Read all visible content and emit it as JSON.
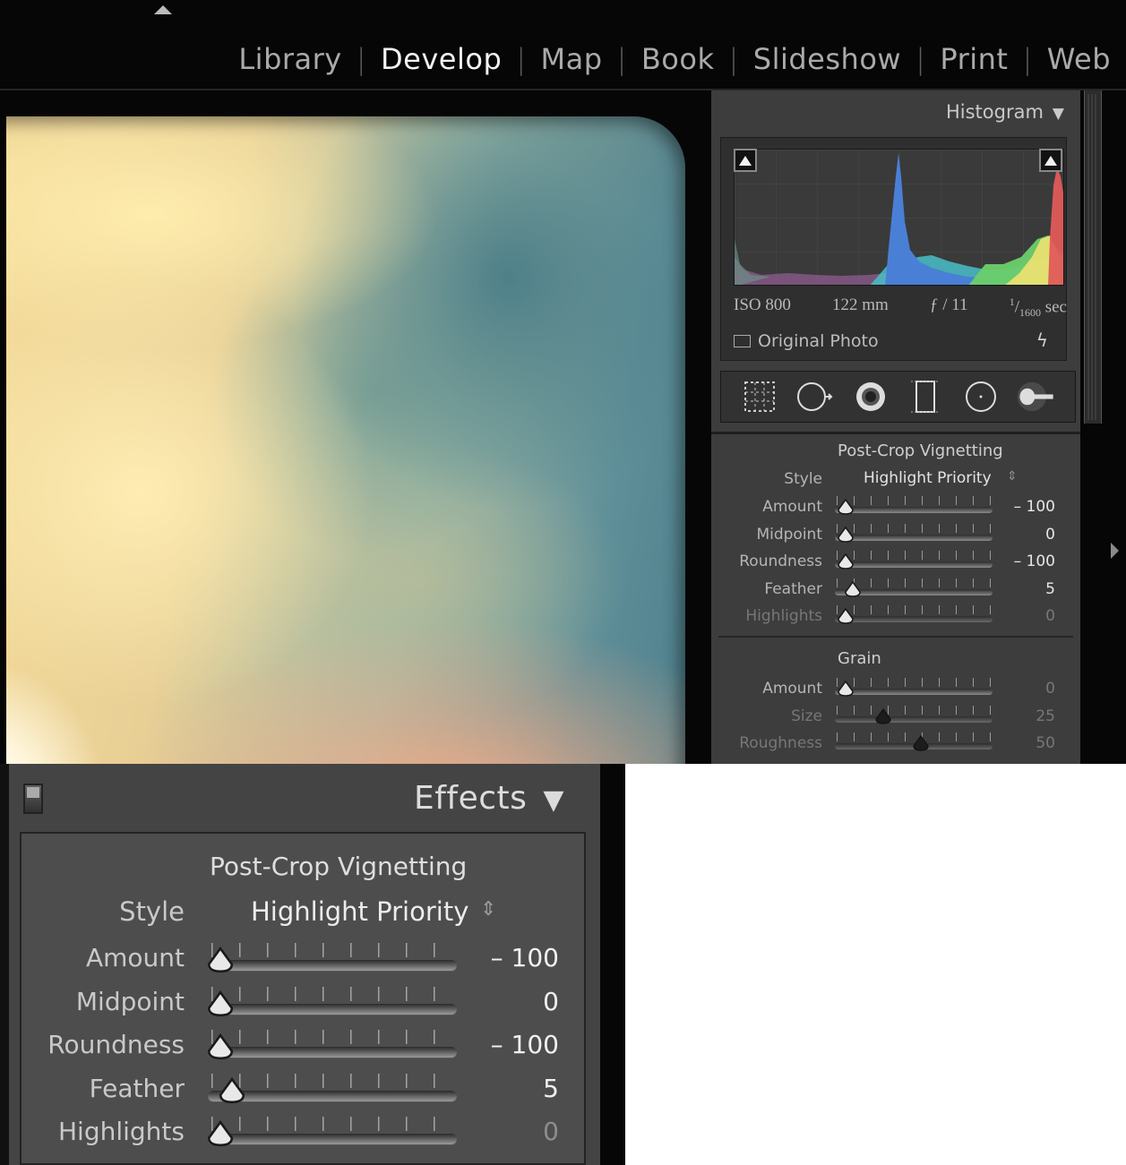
{
  "module_nav": {
    "items": [
      {
        "label": "Library",
        "active": false
      },
      {
        "label": "Develop",
        "active": true
      },
      {
        "label": "Map",
        "active": false
      },
      {
        "label": "Book",
        "active": false
      },
      {
        "label": "Slideshow",
        "active": false
      },
      {
        "label": "Print",
        "active": false
      },
      {
        "label": "Web",
        "active": false
      }
    ],
    "separator": "|"
  },
  "histogram": {
    "title": "Histogram",
    "collapse_icon": "triangle-down-icon",
    "exif": {
      "iso": "ISO 800",
      "focal_length": "122 mm",
      "aperture": "ƒ / 11",
      "shutter_num": "1",
      "shutter_den": "1600",
      "shutter_unit": "sec"
    },
    "original_photo_label": "Original Photo",
    "bolt_icon": "lightning-icon"
  },
  "tools": [
    {
      "name": "crop-overlay-icon",
      "glyph": "⬚"
    },
    {
      "name": "spot-removal-icon",
      "glyph": "◯"
    },
    {
      "name": "red-eye-icon",
      "glyph": "◉"
    },
    {
      "name": "graduated-filter-icon",
      "glyph": "▯"
    },
    {
      "name": "radial-filter-icon",
      "glyph": "◌"
    },
    {
      "name": "adjustment-brush-icon",
      "glyph": "⊶"
    }
  ],
  "vignetting": {
    "title": "Post-Crop Vignetting",
    "style_label": "Style",
    "style_value": "Highlight Priority",
    "sliders": [
      {
        "key": "amount",
        "label": "Amount",
        "value": "– 100",
        "fraction": 0.0,
        "dim": false
      },
      {
        "key": "midpoint",
        "label": "Midpoint",
        "value": "0",
        "fraction": 0.0,
        "dim": false
      },
      {
        "key": "roundness",
        "label": "Roundness",
        "value": "– 100",
        "fraction": 0.0,
        "dim": false
      },
      {
        "key": "feather",
        "label": "Feather",
        "value": "5",
        "fraction": 0.05,
        "dim": false
      },
      {
        "key": "highlights",
        "label": "Highlights",
        "value": "0",
        "fraction": 0.0,
        "dim": true
      }
    ]
  },
  "grain": {
    "title": "Grain",
    "sliders": [
      {
        "key": "amount",
        "label": "Amount",
        "value": "0",
        "fraction": 0.0,
        "dim": false
      },
      {
        "key": "size",
        "label": "Size",
        "value": "25",
        "fraction": 0.25,
        "dim": true
      },
      {
        "key": "roughness",
        "label": "Roughness",
        "value": "50",
        "fraction": 0.5,
        "dim": true
      }
    ]
  },
  "effects": {
    "title": "Effects",
    "collapse_icon": "triangle-down-icon"
  },
  "colors": {
    "panel_bg": "#444444",
    "app_bg": "#060606",
    "active_module": "#f2f2f2",
    "hist_blue": "#4a7fd6",
    "hist_red": "#e05a5a",
    "hist_green": "#6ccf6c",
    "hist_yellow": "#e8e070"
  }
}
